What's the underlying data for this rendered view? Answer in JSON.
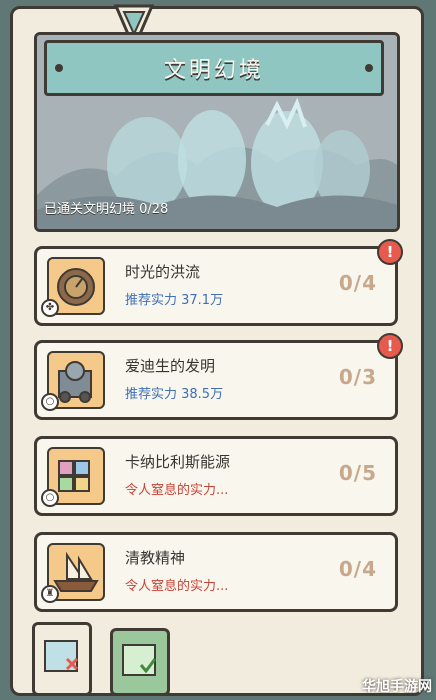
{
  "header": {
    "title": "文明幻境",
    "progress_label": "已通关文明幻境 0/28"
  },
  "cards": [
    {
      "name": "时光的洪流",
      "subtitle": "推荐实力 37.1万",
      "subtitle_type": "recommend",
      "count": "0/4",
      "alert": true,
      "thumb_icon": "clock-icon",
      "corner_icon": "fan-icon"
    },
    {
      "name": "爱迪生的发明",
      "subtitle": "推荐实力 38.5万",
      "subtitle_type": "recommend",
      "count": "0/3",
      "alert": true,
      "thumb_icon": "machine-icon",
      "corner_icon": "bulb-icon"
    },
    {
      "name": "卡纳比利斯能源",
      "subtitle": "令人窒息的实力...",
      "subtitle_type": "warning",
      "count": "0/5",
      "alert": false,
      "thumb_icon": "crystal-icon",
      "corner_icon": "bulb-icon"
    },
    {
      "name": "清教精神",
      "subtitle": "令人窒息的实力...",
      "subtitle_type": "warning",
      "count": "0/4",
      "alert": false,
      "thumb_icon": "ship-icon",
      "corner_icon": "trophy-icon"
    }
  ],
  "alert_glyph": "!",
  "watermark": "华旭手游网",
  "colors": {
    "recommend": "#3e6fb8",
    "warning": "#c8443a",
    "alert": "#e65b4e",
    "title_plate": "#8fc6c2"
  }
}
